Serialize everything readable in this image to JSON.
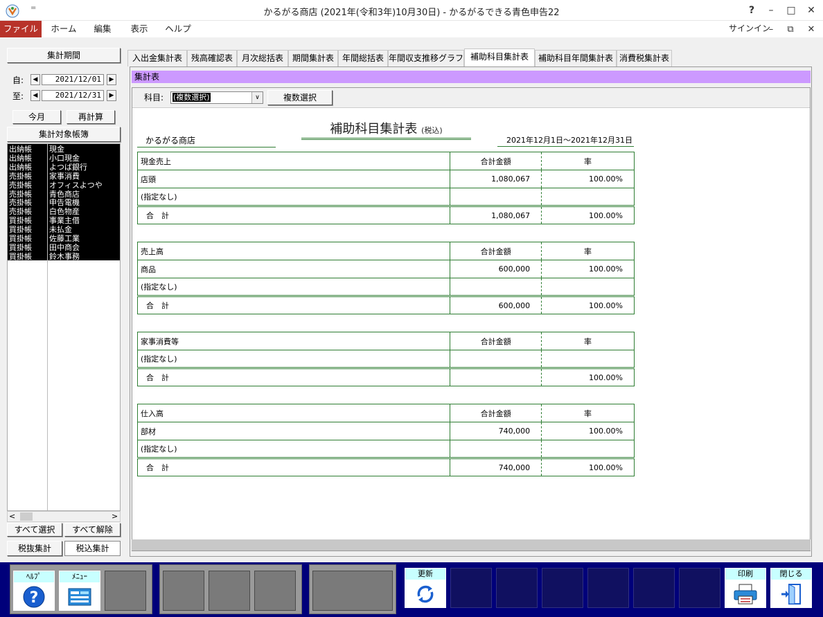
{
  "window": {
    "title": "かるがる商店 (2021年(令和3年)10月30日) - かるがるできる青色申告22",
    "quick_access": "=",
    "help_glyph": "?",
    "minimize_glyph": "–",
    "maximize_glyph": "□",
    "close_glyph": "✕"
  },
  "menubar": {
    "items": [
      "ファイル",
      "ホーム",
      "編集",
      "表示",
      "ヘルプ"
    ],
    "signin": "サインイン",
    "doc_minimize": "–",
    "doc_restore": "⧉",
    "doc_close": "✕"
  },
  "left": {
    "period_header": "集計期間",
    "from_label": "自:",
    "to_label": "至:",
    "date_from": "2021/12/01",
    "date_to": "2021/12/31",
    "arrow_left": "◀",
    "arrow_right": "▶",
    "this_month": "今月",
    "recalc": "再計算",
    "ledger_header": "集計対象帳簿",
    "ledgers": [
      {
        "type": "出納帳",
        "name": "現金"
      },
      {
        "type": "出納帳",
        "name": "小口現金"
      },
      {
        "type": "出納帳",
        "name": "よつば銀行"
      },
      {
        "type": "売掛帳",
        "name": "家事消費"
      },
      {
        "type": "売掛帳",
        "name": "オフィスよつや"
      },
      {
        "type": "売掛帳",
        "name": "青色商店"
      },
      {
        "type": "売掛帳",
        "name": "申告電機"
      },
      {
        "type": "売掛帳",
        "name": "白色物産"
      },
      {
        "type": "買掛帳",
        "name": "事業主借"
      },
      {
        "type": "買掛帳",
        "name": "未払金"
      },
      {
        "type": "買掛帳",
        "name": "佐藤工業"
      },
      {
        "type": "買掛帳",
        "name": "田中商会"
      },
      {
        "type": "買掛帳",
        "name": "鈴木事務"
      }
    ],
    "scroll_left": "<",
    "scroll_right": ">",
    "select_all": "すべて選択",
    "deselect_all": "すべて解除",
    "tax_excluded": "税抜集計",
    "tax_included": "税込集計"
  },
  "tabs": [
    "入出金集計表",
    "残高確認表",
    "月次総括表",
    "期間集計表",
    "年間総括表",
    "年間収支推移グラフ",
    "補助科目集計表",
    "補助科目年間集計表",
    "消費税集計表"
  ],
  "active_tab": "補助科目集計表",
  "section_title": "集計表",
  "filter": {
    "label": "科目:",
    "selected": "(複数選択)",
    "dropdown_glyph": "∨",
    "multi_button": "複数選択"
  },
  "report": {
    "title": "補助科目集計表",
    "title_suffix": "(税込)",
    "shop": "かるがる商店",
    "range": "2021年12月1日～2021年12月31日",
    "col_amount": "合計金額",
    "col_rate": "率",
    "total_label": "合　計",
    "sections": [
      {
        "account": "現金売上",
        "rows": [
          {
            "name": "店頭",
            "amount": "1,080,067",
            "rate": "100.00%"
          },
          {
            "name": "(指定なし)",
            "amount": "",
            "rate": ""
          }
        ],
        "total_amount": "1,080,067",
        "total_rate": "100.00%"
      },
      {
        "account": "売上高",
        "rows": [
          {
            "name": "商品",
            "amount": "600,000",
            "rate": "100.00%"
          },
          {
            "name": "(指定なし)",
            "amount": "",
            "rate": ""
          }
        ],
        "total_amount": "600,000",
        "total_rate": "100.00%"
      },
      {
        "account": "家事消費等",
        "rows": [
          {
            "name": "(指定なし)",
            "amount": "",
            "rate": ""
          }
        ],
        "total_amount": "",
        "total_rate": "100.00%"
      },
      {
        "account": "仕入高",
        "rows": [
          {
            "name": "部材",
            "amount": "740,000",
            "rate": "100.00%"
          },
          {
            "name": "(指定なし)",
            "amount": "",
            "rate": ""
          }
        ],
        "total_amount": "740,000",
        "total_rate": "100.00%"
      }
    ]
  },
  "fkeys": {
    "help": "ﾍﾙﾌﾟ",
    "menu": "ﾒﾆｭｰ",
    "update": "更新",
    "print": "印刷",
    "close": "閉じる"
  }
}
